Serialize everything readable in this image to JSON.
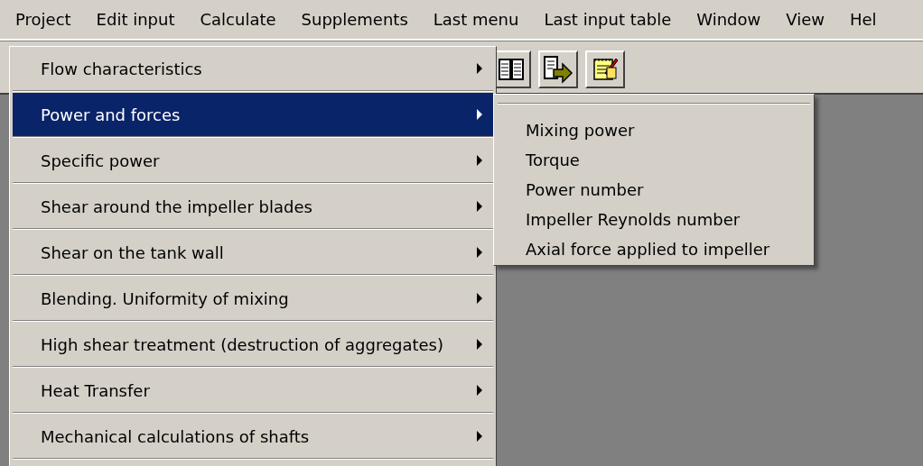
{
  "menubar": [
    {
      "label": "Project"
    },
    {
      "label": "Edit input"
    },
    {
      "label": "Calculate"
    },
    {
      "label": "Supplements"
    },
    {
      "label": "Last menu"
    },
    {
      "label": "Last input table"
    },
    {
      "label": "Window"
    },
    {
      "label": "View"
    },
    {
      "label": "Hel"
    }
  ],
  "menu": {
    "items": [
      {
        "label": "Flow characteristics",
        "has_submenu": true,
        "selected": false
      },
      {
        "label": "Power and forces",
        "has_submenu": true,
        "selected": true
      },
      {
        "label": "Specific power",
        "has_submenu": true,
        "selected": false
      },
      {
        "label": "Shear around the impeller blades",
        "has_submenu": true,
        "selected": false
      },
      {
        "label": "Shear on the tank wall",
        "has_submenu": true,
        "selected": false
      },
      {
        "label": "Blending. Uniformity of mixing",
        "has_submenu": true,
        "selected": false
      },
      {
        "label": "High shear treatment (destruction of aggregates)",
        "has_submenu": true,
        "selected": false
      },
      {
        "label": "Heat Transfer",
        "has_submenu": true,
        "selected": false
      },
      {
        "label": "Mechanical calculations of shafts",
        "has_submenu": true,
        "selected": false
      }
    ]
  },
  "submenu": {
    "items": [
      {
        "label": "Mixing power"
      },
      {
        "label": "Torque"
      },
      {
        "label": "Power number"
      },
      {
        "label": "Impeller Reynolds number"
      },
      {
        "label": "Axial force applied to impeller"
      }
    ]
  }
}
